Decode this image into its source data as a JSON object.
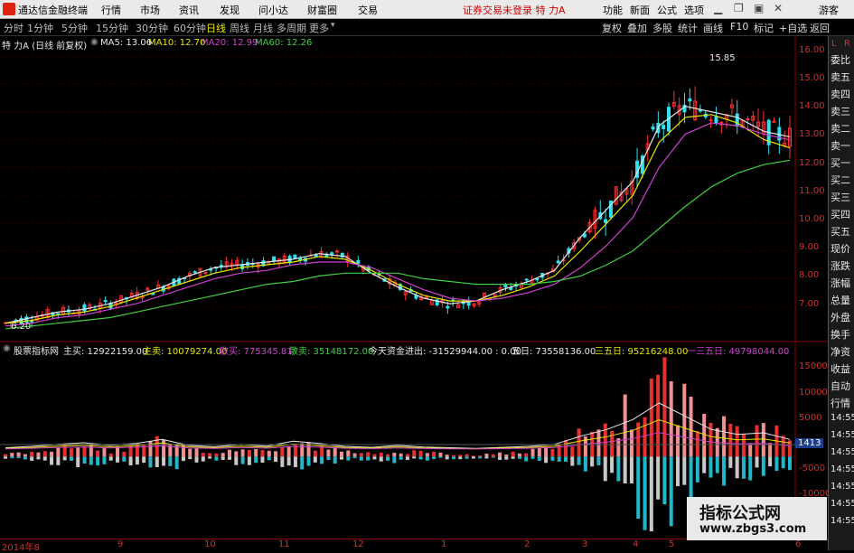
{
  "menubar": {
    "app_title": "通达信金融终端",
    "items": [
      "行情",
      "市场",
      "资讯",
      "发现",
      "问小达",
      "财富圈",
      "交易"
    ],
    "status": "证券交易未登录  特 力A",
    "right_items": [
      "功能",
      "新面",
      "公式",
      "选项"
    ],
    "guest": "游客"
  },
  "toolbar": {
    "timeframes": [
      "分时",
      "1分钟",
      "5分钟",
      "15分钟",
      "30分钟",
      "60分钟",
      "日线",
      "周线",
      "月线",
      "多周期",
      "更多"
    ],
    "active": "日线",
    "buttons": [
      "复权",
      "叠加",
      "多股",
      "统计",
      "画线",
      "F10",
      "标记",
      "+自选",
      "返回"
    ]
  },
  "price_panel": {
    "title": "特 力A (日线 前复权)",
    "ma_labels": [
      {
        "text": "MA5: 13.06",
        "color": "#e8e8e8"
      },
      {
        "text": "MA10: 12.70",
        "color": "#e8e800"
      },
      {
        "text": "MA20: 12.99",
        "color": "#d040d0"
      },
      {
        "text": "MA60: 12.26",
        "color": "#40d040"
      }
    ],
    "high_label": "15.85",
    "low_label": "6.20",
    "axis_ticks": [
      "16.00",
      "15.00",
      "14.00",
      "13.00",
      "12.00",
      "11.00",
      "10.00",
      "9.00",
      "8.00",
      "7.00"
    ]
  },
  "indicator_panel": {
    "title": "股票指标网",
    "fields": [
      {
        "text": "主买: 12922159.00",
        "color": "#e8e8e8"
      },
      {
        "text": "主卖: 10079274.00",
        "color": "#e8e800"
      },
      {
        "text": "散买: 775345.81",
        "color": "#d040d0"
      },
      {
        "text": "散卖: 35148172.00",
        "color": "#40d040"
      },
      {
        "text": "今天资金进出: -31529944.00 : 0.00",
        "color": "#e8e8e8"
      },
      {
        "text": "五日: 73558136.00",
        "color": "#e8e8e8"
      },
      {
        "text": "三五日: 95216248.00",
        "color": "#e8e800"
      },
      {
        "text": "一三五日: 49798044.00",
        "color": "#d040d0"
      }
    ],
    "axis_ticks": [
      "15000",
      "10000",
      "5000",
      "1413",
      "-5000",
      "-10000"
    ]
  },
  "right_panel": {
    "top": [
      "L",
      "R"
    ],
    "items": [
      "委比",
      "卖五",
      "卖四",
      "卖三",
      "卖二",
      "卖一",
      "买一",
      "买二",
      "买三",
      "买四",
      "买五",
      "现价",
      "涨跌",
      "涨幅",
      "总量",
      "外盘",
      "换手",
      "净资",
      "收益",
      "自动",
      "行情",
      "14:55",
      "14:55",
      "14:55",
      "14:55",
      "14:55",
      "14:55",
      "14:55"
    ]
  },
  "date_axis": [
    "2014年8",
    "9",
    "10",
    "11",
    "12",
    "1",
    "2",
    "3",
    "4",
    "5",
    "6"
  ],
  "watermark": {
    "line1": "指标公式网",
    "line2": "www.zbgs3.com"
  },
  "chart_data": [
    {
      "type": "line",
      "title": "特 力A (日线 前复权)",
      "ylim": [
        6,
        16.2
      ],
      "series": [
        {
          "name": "MA5",
          "color": "#e8e8e8",
          "values": [
            6.4,
            6.6,
            6.8,
            6.9,
            7.1,
            7.4,
            7.7,
            8.1,
            8.4,
            8.5,
            8.6,
            8.7,
            8.9,
            8.8,
            8.2,
            7.7,
            7.3,
            7.1,
            7.2,
            7.6,
            7.9,
            8.3,
            9.5,
            10.5,
            11.5,
            13.5,
            14.2,
            14.0,
            13.8,
            13.3,
            13.1
          ]
        },
        {
          "name": "MA10",
          "color": "#e8e800",
          "values": [
            6.4,
            6.5,
            6.7,
            6.8,
            7.0,
            7.3,
            7.6,
            7.9,
            8.2,
            8.4,
            8.5,
            8.6,
            8.8,
            8.7,
            8.3,
            7.8,
            7.4,
            7.2,
            7.2,
            7.4,
            7.7,
            8.1,
            9.0,
            10.0,
            11.0,
            12.9,
            13.8,
            13.9,
            13.6,
            13.0,
            12.7
          ]
        },
        {
          "name": "MA20",
          "color": "#d040d0",
          "values": [
            6.3,
            6.4,
            6.6,
            6.7,
            6.9,
            7.1,
            7.4,
            7.7,
            8.0,
            8.2,
            8.3,
            8.5,
            8.6,
            8.6,
            8.4,
            8.0,
            7.6,
            7.3,
            7.2,
            7.3,
            7.5,
            7.8,
            8.4,
            9.2,
            10.2,
            12.0,
            13.2,
            13.6,
            13.5,
            13.2,
            12.99
          ]
        },
        {
          "name": "MA60",
          "color": "#40d040",
          "values": [
            6.2,
            6.3,
            6.4,
            6.5,
            6.6,
            6.8,
            7.0,
            7.2,
            7.4,
            7.6,
            7.8,
            7.9,
            8.1,
            8.2,
            8.2,
            8.2,
            8.0,
            7.9,
            7.8,
            7.8,
            7.8,
            7.9,
            8.1,
            8.5,
            9.0,
            9.8,
            10.6,
            11.3,
            11.8,
            12.1,
            12.26
          ]
        }
      ]
    },
    {
      "type": "bar",
      "title": "股票指标网",
      "ylim": [
        -13000,
        17000
      ],
      "series": [
        {
          "name": "主买",
          "color": "#e83030",
          "values": [
            500,
            900,
            1500,
            2000,
            1200,
            1800,
            3000,
            1200,
            800,
            1500,
            1000,
            2500,
            1800,
            900,
            600,
            1200,
            700,
            500,
            300,
            600,
            900,
            1500,
            4000,
            6000,
            9000,
            14000,
            10000,
            6000,
            4500,
            5000,
            3000
          ]
        },
        {
          "name": "散卖",
          "color": "#20b8c8",
          "values": [
            -400,
            -800,
            -1200,
            -1500,
            -900,
            -1500,
            -2500,
            -1000,
            -700,
            -1200,
            -900,
            -1800,
            -1500,
            -700,
            -500,
            -900,
            -600,
            -400,
            -300,
            -500,
            -700,
            -1100,
            -2500,
            -4000,
            -8000,
            -12000,
            -9000,
            -6000,
            -4000,
            -3000,
            -1800
          ]
        }
      ]
    }
  ]
}
